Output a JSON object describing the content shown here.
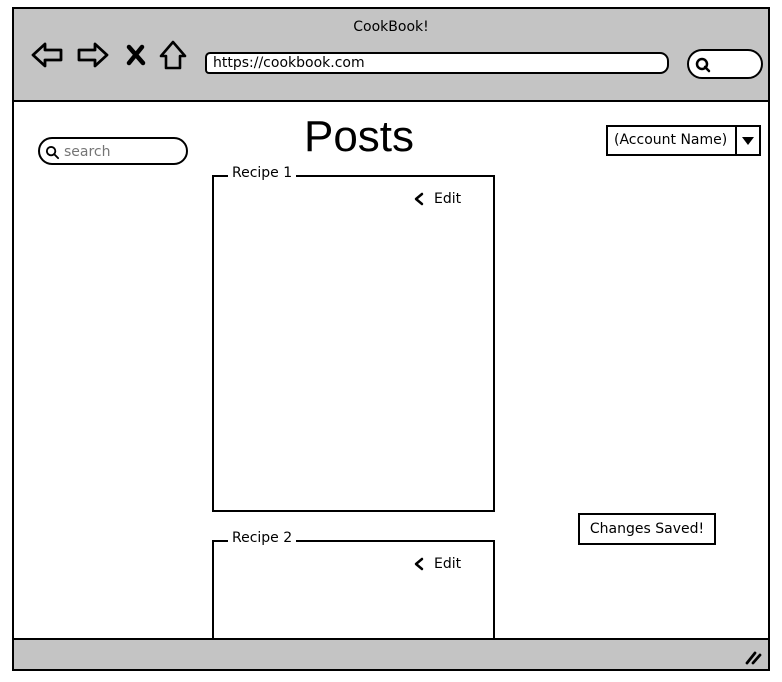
{
  "window": {
    "title": "CookBook!"
  },
  "toolbar": {
    "back_icon": "back-arrow-icon",
    "forward_icon": "forward-arrow-icon",
    "stop_icon": "stop-x-icon",
    "home_icon": "home-icon",
    "url": "https://cookbook.com",
    "search_icon": "search-icon"
  },
  "sidebar": {
    "search_placeholder": "search"
  },
  "main": {
    "title": "Posts",
    "account": {
      "label": "(Account Name)"
    },
    "posts": [
      {
        "legend": "Recipe 1",
        "edit_label": "Edit"
      },
      {
        "legend": "Recipe 2",
        "edit_label": "Edit"
      }
    ],
    "status_message": "Changes Saved!"
  },
  "colors": {
    "chrome": "#c4c4c4",
    "border": "#000000",
    "placeholder": "#7a7a7a"
  }
}
